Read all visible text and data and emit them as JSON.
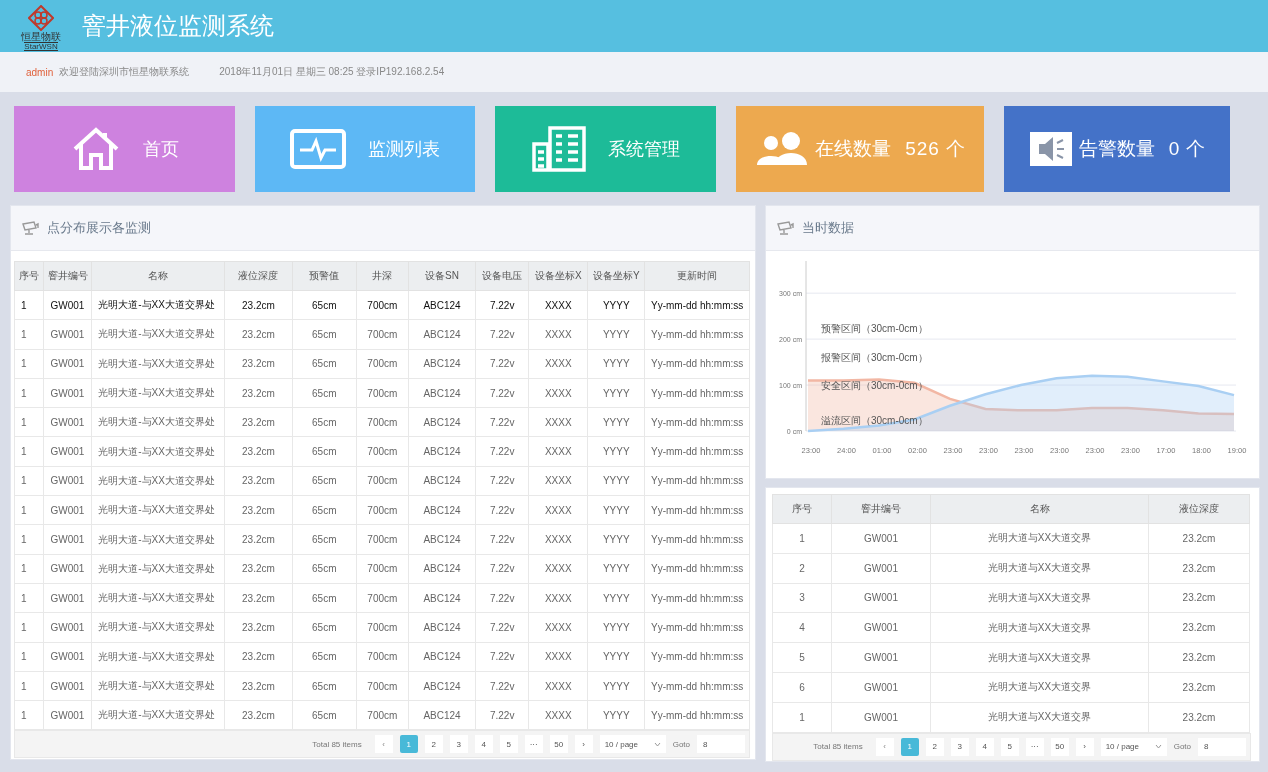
{
  "header": {
    "logo_text": "恒星物联",
    "logo_subtext": "StarWSN",
    "title": "窨井液位监测系统"
  },
  "info_bar": {
    "user": "admin",
    "welcome": "欢迎登陆深圳市恒星物联系统",
    "datetime": "2018年11月01日 星期三 08:25 登录IP192.168.2.54"
  },
  "tiles": [
    {
      "kind": "nav",
      "label": "首页",
      "color": "#ce82df"
    },
    {
      "kind": "nav",
      "label": "监测列表",
      "color": "#5db8f5"
    },
    {
      "kind": "nav",
      "label": "系统管理",
      "color": "#1dbb98"
    },
    {
      "kind": "stat",
      "label": "在线数量",
      "value": "526",
      "unit": "个",
      "color": "#eda94f"
    },
    {
      "kind": "stat",
      "label": "告警数量",
      "value": "0",
      "unit": "个",
      "color": "#4472c8"
    }
  ],
  "left_panel": {
    "title": "点分布展示各监测",
    "table": {
      "columns": [
        "序号",
        "窨井编号",
        "名称",
        "液位深度",
        "预警值",
        "井深",
        "设备SN",
        "设备电压",
        "设备坐标X",
        "设备坐标Y",
        "更新时间"
      ],
      "rows": [
        {
          "selected": true,
          "cells": [
            "1",
            "GW001",
            "光明大道-与XX大道交界处",
            "23.2cm",
            "65cm",
            "700cm",
            "ABC124",
            "7.22v",
            "XXXX",
            "YYYY",
            "Yy-mm-dd hh:mm:ss"
          ]
        },
        {
          "selected": false,
          "cells": [
            "1",
            "GW001",
            "光明大道-与XX大道交界处",
            "23.2cm",
            "65cm",
            "700cm",
            "ABC124",
            "7.22v",
            "XXXX",
            "YYYY",
            "Yy-mm-dd hh:mm:ss"
          ]
        },
        {
          "selected": false,
          "cells": [
            "1",
            "GW001",
            "光明大道-与XX大道交界处",
            "23.2cm",
            "65cm",
            "700cm",
            "ABC124",
            "7.22v",
            "XXXX",
            "YYYY",
            "Yy-mm-dd hh:mm:ss"
          ]
        },
        {
          "selected": false,
          "cells": [
            "1",
            "GW001",
            "光明大道-与XX大道交界处",
            "23.2cm",
            "65cm",
            "700cm",
            "ABC124",
            "7.22v",
            "XXXX",
            "YYYY",
            "Yy-mm-dd hh:mm:ss"
          ]
        },
        {
          "selected": false,
          "cells": [
            "1",
            "GW001",
            "光明大道-与XX大道交界处",
            "23.2cm",
            "65cm",
            "700cm",
            "ABC124",
            "7.22v",
            "XXXX",
            "YYYY",
            "Yy-mm-dd hh:mm:ss"
          ]
        },
        {
          "selected": false,
          "cells": [
            "1",
            "GW001",
            "光明大道-与XX大道交界处",
            "23.2cm",
            "65cm",
            "700cm",
            "ABC124",
            "7.22v",
            "XXXX",
            "YYYY",
            "Yy-mm-dd hh:mm:ss"
          ]
        },
        {
          "selected": false,
          "cells": [
            "1",
            "GW001",
            "光明大道-与XX大道交界处",
            "23.2cm",
            "65cm",
            "700cm",
            "ABC124",
            "7.22v",
            "XXXX",
            "YYYY",
            "Yy-mm-dd hh:mm:ss"
          ]
        },
        {
          "selected": false,
          "cells": [
            "1",
            "GW001",
            "光明大道-与XX大道交界处",
            "23.2cm",
            "65cm",
            "700cm",
            "ABC124",
            "7.22v",
            "XXXX",
            "YYYY",
            "Yy-mm-dd hh:mm:ss"
          ]
        },
        {
          "selected": false,
          "cells": [
            "1",
            "GW001",
            "光明大道-与XX大道交界处",
            "23.2cm",
            "65cm",
            "700cm",
            "ABC124",
            "7.22v",
            "XXXX",
            "YYYY",
            "Yy-mm-dd hh:mm:ss"
          ]
        },
        {
          "selected": false,
          "cells": [
            "1",
            "GW001",
            "光明大道-与XX大道交界处",
            "23.2cm",
            "65cm",
            "700cm",
            "ABC124",
            "7.22v",
            "XXXX",
            "YYYY",
            "Yy-mm-dd hh:mm:ss"
          ]
        },
        {
          "selected": false,
          "cells": [
            "1",
            "GW001",
            "光明大道-与XX大道交界处",
            "23.2cm",
            "65cm",
            "700cm",
            "ABC124",
            "7.22v",
            "XXXX",
            "YYYY",
            "Yy-mm-dd hh:mm:ss"
          ]
        },
        {
          "selected": false,
          "cells": [
            "1",
            "GW001",
            "光明大道-与XX大道交界处",
            "23.2cm",
            "65cm",
            "700cm",
            "ABC124",
            "7.22v",
            "XXXX",
            "YYYY",
            "Yy-mm-dd hh:mm:ss"
          ]
        },
        {
          "selected": false,
          "cells": [
            "1",
            "GW001",
            "光明大道-与XX大道交界处",
            "23.2cm",
            "65cm",
            "700cm",
            "ABC124",
            "7.22v",
            "XXXX",
            "YYYY",
            "Yy-mm-dd hh:mm:ss"
          ]
        },
        {
          "selected": false,
          "cells": [
            "1",
            "GW001",
            "光明大道-与XX大道交界处",
            "23.2cm",
            "65cm",
            "700cm",
            "ABC124",
            "7.22v",
            "XXXX",
            "YYYY",
            "Yy-mm-dd hh:mm:ss"
          ]
        },
        {
          "selected": false,
          "cells": [
            "1",
            "GW001",
            "光明大道-与XX大道交界处",
            "23.2cm",
            "65cm",
            "700cm",
            "ABC124",
            "7.22v",
            "XXXX",
            "YYYY",
            "Yy-mm-dd hh:mm:ss"
          ]
        }
      ]
    },
    "pagination": {
      "total": "Total 85 items",
      "prev": "‹",
      "next": "›",
      "pages": [
        {
          "label": "1",
          "selected": true
        },
        {
          "label": "2",
          "selected": false
        },
        {
          "label": "3",
          "selected": false
        },
        {
          "label": "4",
          "selected": false
        },
        {
          "label": "5",
          "selected": false
        },
        {
          "label": "···",
          "selected": false
        },
        {
          "label": "50",
          "selected": false
        }
      ],
      "page_size": "10 / page",
      "goto_label": "Goto",
      "goto_value": "8"
    }
  },
  "chart_panel": {
    "title": "当时数据",
    "chart_data": {
      "type": "area",
      "categories": [
        "23:00",
        "24:00",
        "01:00",
        "02:00",
        "23:00",
        "23:00",
        "23:00",
        "23:00",
        "23:00",
        "23:00",
        "17:00",
        "18:00",
        "19:00"
      ],
      "series": [
        {
          "color": "#f2b7a4",
          "values": [
            110,
            110,
            112,
            105,
            70,
            48,
            45,
            45,
            50,
            50,
            45,
            38,
            37
          ]
        },
        {
          "color": "#a9cff3",
          "values": [
            0,
            5,
            12,
            25,
            55,
            80,
            100,
            115,
            120,
            118,
            108,
            98,
            78
          ]
        }
      ],
      "ylim": [
        0,
        370
      ],
      "yticks": [
        {
          "value": 0,
          "label": "0 cm"
        },
        {
          "value": 100,
          "label": "100 cm"
        },
        {
          "value": 200,
          "label": "200 cm"
        },
        {
          "value": 300,
          "label": "300 cm"
        }
      ],
      "grid": true,
      "annotations": [
        "预警区间（30cm-0cm）",
        "报警区间（30cm-0cm）",
        "安全区间（30cm-0cm）",
        "溢流区间（30cm-0cm）"
      ]
    }
  },
  "right_panel": {
    "table": {
      "columns": [
        "序号",
        "窨井编号",
        "名称",
        "液位深度"
      ],
      "rows": [
        {
          "cells": [
            "1",
            "GW001",
            "光明大道与XX大道交界",
            "23.2cm"
          ]
        },
        {
          "cells": [
            "2",
            "GW001",
            "光明大道与XX大道交界",
            "23.2cm"
          ]
        },
        {
          "cells": [
            "3",
            "GW001",
            "光明大道与XX大道交界",
            "23.2cm"
          ]
        },
        {
          "cells": [
            "4",
            "GW001",
            "光明大道与XX大道交界",
            "23.2cm"
          ]
        },
        {
          "cells": [
            "5",
            "GW001",
            "光明大道与XX大道交界",
            "23.2cm"
          ]
        },
        {
          "cells": [
            "6",
            "GW001",
            "光明大道与XX大道交界",
            "23.2cm"
          ]
        },
        {
          "cells": [
            "1",
            "GW001",
            "光明大道与XX大道交界",
            "23.2cm"
          ]
        }
      ]
    },
    "pagination": {
      "total": "Total 85 items",
      "prev": "‹",
      "next": "›",
      "pages": [
        {
          "label": "1",
          "selected": true
        },
        {
          "label": "2",
          "selected": false
        },
        {
          "label": "3",
          "selected": false
        },
        {
          "label": "4",
          "selected": false
        },
        {
          "label": "5",
          "selected": false
        },
        {
          "label": "···",
          "selected": false
        },
        {
          "label": "50",
          "selected": false
        }
      ],
      "page_size": "10 / page",
      "goto_label": "Goto",
      "goto_value": "8"
    }
  }
}
